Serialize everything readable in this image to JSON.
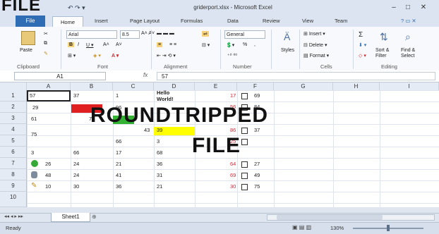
{
  "window": {
    "title": "griderport.xlsx - Microsoft Excel",
    "min": "–",
    "max": "□",
    "close": "✕"
  },
  "overlays": {
    "top_left": "FILE",
    "line1": "ROUNDTRIPPED",
    "line2": "FILE"
  },
  "tabs": [
    "File",
    "Home",
    "Insert",
    "Page Layout",
    "Formulas",
    "Data",
    "Review",
    "View",
    "Team"
  ],
  "ribbon": {
    "clipboard": {
      "label": "Clipboard",
      "paste": "Paste"
    },
    "font": {
      "label": "Font",
      "name": "Arial",
      "size": "8.5"
    },
    "alignment": {
      "label": "Alignment"
    },
    "number": {
      "label": "Number",
      "format": "General",
      "pct": "%",
      "comma": ","
    },
    "styles": {
      "label": "Styles"
    },
    "cells": {
      "label": "Cells",
      "insert": "Insert",
      "delete": "Delete",
      "format": "Format"
    },
    "editing": {
      "label": "Editing",
      "sort": "Sort & Filter",
      "find": "Find & Select",
      "sigma": "Σ"
    }
  },
  "formula_bar": {
    "name_box": "A1",
    "fx": "fx",
    "value": "57"
  },
  "columns": [
    "A",
    "B",
    "C",
    "D",
    "E",
    "F",
    "G",
    "H",
    "I"
  ],
  "rows": [
    "1",
    "2",
    "3",
    "4",
    "5",
    "6",
    "7",
    "8",
    "9",
    "10"
  ],
  "cells": {
    "a1": "57",
    "b1": "37",
    "c1": "1",
    "d1": "Hello",
    "d1b": "World!",
    "e1": "17",
    "f1": "69",
    "a2": "29",
    "c2": "96",
    "e2": "56",
    "f2": "84",
    "a3": "61",
    "b3": "7",
    "d4": "43",
    "d4b": "39",
    "e4": "86",
    "f4": "37",
    "a4": "75",
    "c5": "66",
    "d5": "3",
    "e5": "25",
    "a6": "3",
    "b6": "66",
    "c6": "17",
    "d6": "68",
    "a7": "26",
    "b7": "24",
    "c7": "21",
    "d7": "36",
    "e7": "64",
    "f7": "27",
    "a8": "48",
    "b8": "24",
    "c8": "41",
    "d8": "31",
    "e8": "69",
    "f8": "49",
    "a9": "10",
    "b9": "30",
    "c9": "36",
    "d9": "21",
    "e9": "30",
    "f9": "75"
  },
  "sheet": {
    "tab": "Sheet1"
  },
  "status": {
    "ready": "Ready",
    "zoom": "130%"
  },
  "colors": {
    "red_fill": "#e02020",
    "green_fill": "#33b233",
    "yellow_fill": "#ffff00",
    "file_tab": "#2f6db5"
  }
}
